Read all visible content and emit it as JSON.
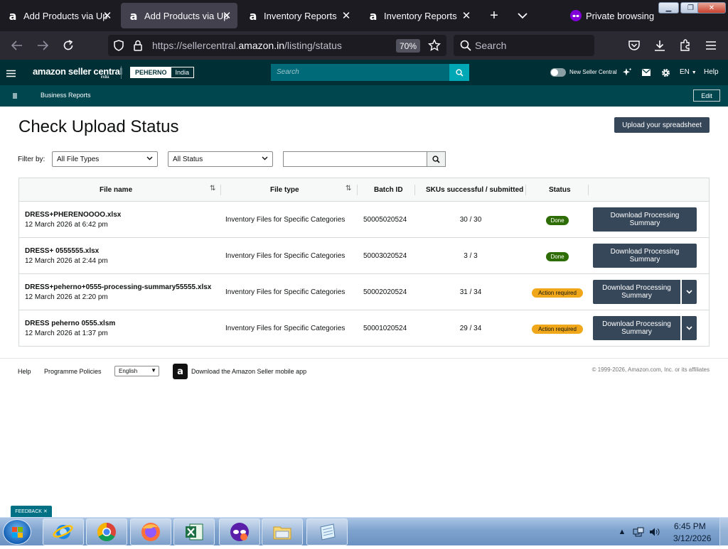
{
  "browser": {
    "tabs": [
      {
        "title": "Add Products via Upl",
        "active": false
      },
      {
        "title": "Add Products via Upl",
        "active": true
      },
      {
        "title": "Inventory Reports",
        "active": false
      },
      {
        "title": "Inventory Reports",
        "active": false
      }
    ],
    "private_label": "Private browsing",
    "url_prefix": "https://sellercentral.",
    "url_domain": "amazon.in",
    "url_path": "/listing/status",
    "zoom": "70%",
    "search_placeholder": "Search"
  },
  "header": {
    "logo": "amazon seller central",
    "logo_sub": "india",
    "account_name": "PEHERNO",
    "account_region": "India",
    "search_placeholder": "Search",
    "toggle_label": "New Seller Central",
    "language": "EN",
    "help": "Help",
    "bookmark_label": "Business Reports",
    "edit_label": "Edit"
  },
  "page": {
    "title": "Check Upload Status",
    "upload_button": "Upload your spreadsheet",
    "filter_label": "Filter by:",
    "file_type_filter": "All File Types",
    "status_filter": "All Status",
    "filter_text_value": ""
  },
  "table": {
    "headers": {
      "file_name": "File name",
      "file_type": "File type",
      "batch_id": "Batch ID",
      "skus": "SKUs successful / submitted",
      "status": "Status"
    },
    "rows": [
      {
        "file_name": "DRESS+PHERENOOOO.xlsx",
        "date": "12 March 2026 at 6:42 pm",
        "file_type": "Inventory Files for Specific Categories",
        "batch_id": "50005020524",
        "skus": "30 / 30",
        "status": "Done",
        "action": "Download Processing Summary"
      },
      {
        "file_name": "DRESS+ 0555555.xlsx",
        "date": "12 March 2026 at 2:44 pm",
        "file_type": "Inventory Files for Specific Categories",
        "batch_id": "50003020524",
        "skus": "3 / 3",
        "status": "Done",
        "action": "Download Processing Summary"
      },
      {
        "file_name": "DRESS+peherno+0555-processing-summary55555.xlsx",
        "date": "12 March 2026 at 2:20 pm",
        "file_type": "Inventory Files for Specific Categories",
        "batch_id": "50002020524",
        "skus": "31 / 34",
        "status": "Action required",
        "action": "Download Processing Summary"
      },
      {
        "file_name": "DRESS peherno 0555.xlsm",
        "date": "12 March 2026 at 1:37 pm",
        "file_type": "Inventory Files for Specific Categories",
        "batch_id": "50001020524",
        "skus": "29 / 34",
        "status": "Action required",
        "action": "Download Processing Summary"
      }
    ]
  },
  "footer": {
    "help": "Help",
    "policies": "Programme Policies",
    "language": "English",
    "app_link": "Download the Amazon Seller mobile app",
    "copyright": "© 1999-2026, Amazon.com, Inc. or its affiliates"
  },
  "feedback": "FEEDBACK",
  "taskbar": {
    "apps": [
      "internet-explorer",
      "chrome",
      "firefox",
      "excel",
      "private-browser",
      "file-explorer",
      "notepad"
    ],
    "time": "6:45 PM",
    "date": "3/12/2026"
  },
  "colors": {
    "browser_bg": "#1c1b22",
    "seller_header": "#002f36",
    "seller_subbar": "#00464f",
    "primary_button": "#37475a",
    "done_badge": "#2e6d05",
    "action_badge": "#f0a81a"
  }
}
